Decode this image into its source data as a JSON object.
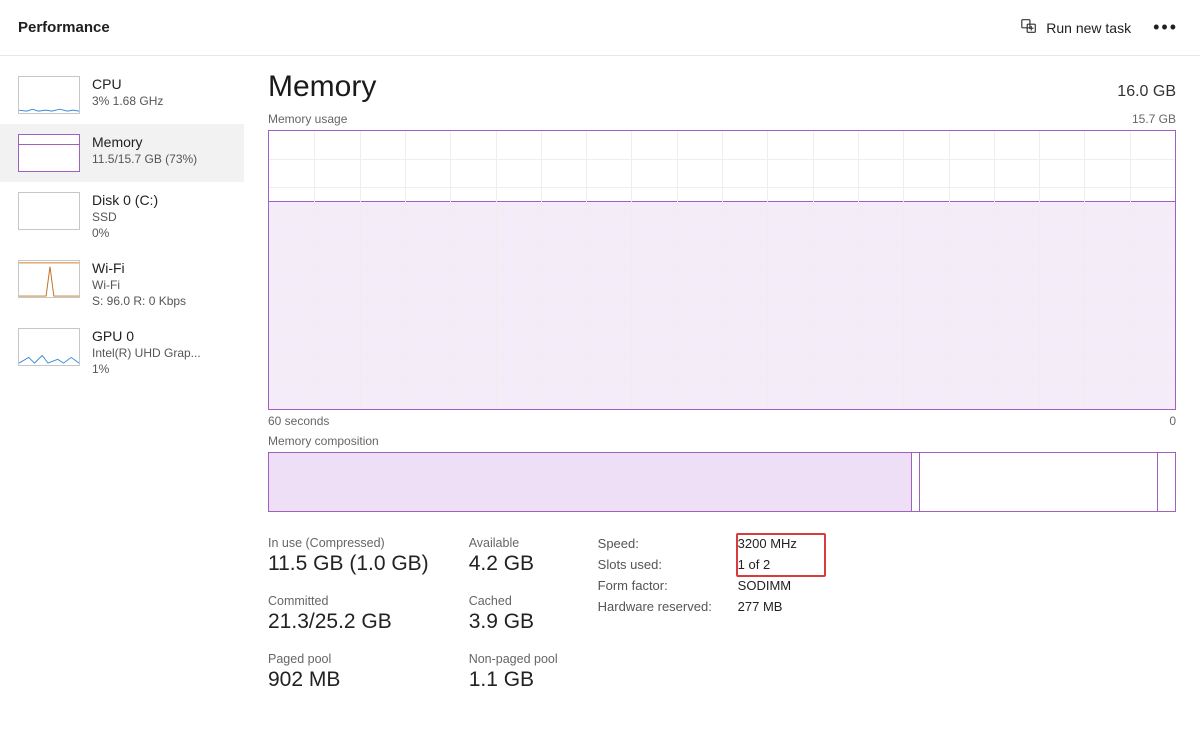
{
  "topbar": {
    "title": "Performance",
    "run_task": "Run new task"
  },
  "sidebar": {
    "items": [
      {
        "title": "CPU",
        "sub": "3%  1.68 GHz"
      },
      {
        "title": "Memory",
        "sub": "11.5/15.7 GB (73%)"
      },
      {
        "title": "Disk 0 (C:)",
        "sub1": "SSD",
        "sub2": "0%"
      },
      {
        "title": "Wi-Fi",
        "sub1": "Wi-Fi",
        "sub2": "S: 96.0 R: 0 Kbps"
      },
      {
        "title": "GPU 0",
        "sub1": "Intel(R) UHD Grap...",
        "sub2": "1%"
      }
    ]
  },
  "main": {
    "title": "Memory",
    "total": "16.0 GB",
    "usage_label": "Memory usage",
    "usage_max": "15.7 GB",
    "axis_left": "60 seconds",
    "axis_right": "0",
    "composition_label": "Memory composition"
  },
  "chart_data": {
    "type": "area",
    "title": "Memory usage",
    "ylabel": "GB",
    "ylim": [
      0,
      15.7
    ],
    "xlabel": "seconds ago",
    "xrange": [
      60,
      0
    ],
    "series": [
      {
        "name": "In use",
        "approx_value_gb": 11.5,
        "note": "flat line at ~73% over window"
      }
    ],
    "composition": {
      "in_use_gb": 11.5,
      "modified_gb": 0.1,
      "standby_free_gb": 4.2,
      "hardware_reserved_mb": 277
    }
  },
  "stats": {
    "in_use_label": "In use (Compressed)",
    "in_use_value": "11.5 GB (1.0 GB)",
    "available_label": "Available",
    "available_value": "4.2 GB",
    "committed_label": "Committed",
    "committed_value": "21.3/25.2 GB",
    "cached_label": "Cached",
    "cached_value": "3.9 GB",
    "paged_label": "Paged pool",
    "paged_value": "902 MB",
    "nonpaged_label": "Non-paged pool",
    "nonpaged_value": "1.1 GB"
  },
  "props": {
    "speed_label": "Speed:",
    "speed_value": "3200 MHz",
    "slots_label": "Slots used:",
    "slots_value": "1 of 2",
    "form_label": "Form factor:",
    "form_value": "SODIMM",
    "hw_label": "Hardware reserved:",
    "hw_value": "277 MB"
  }
}
